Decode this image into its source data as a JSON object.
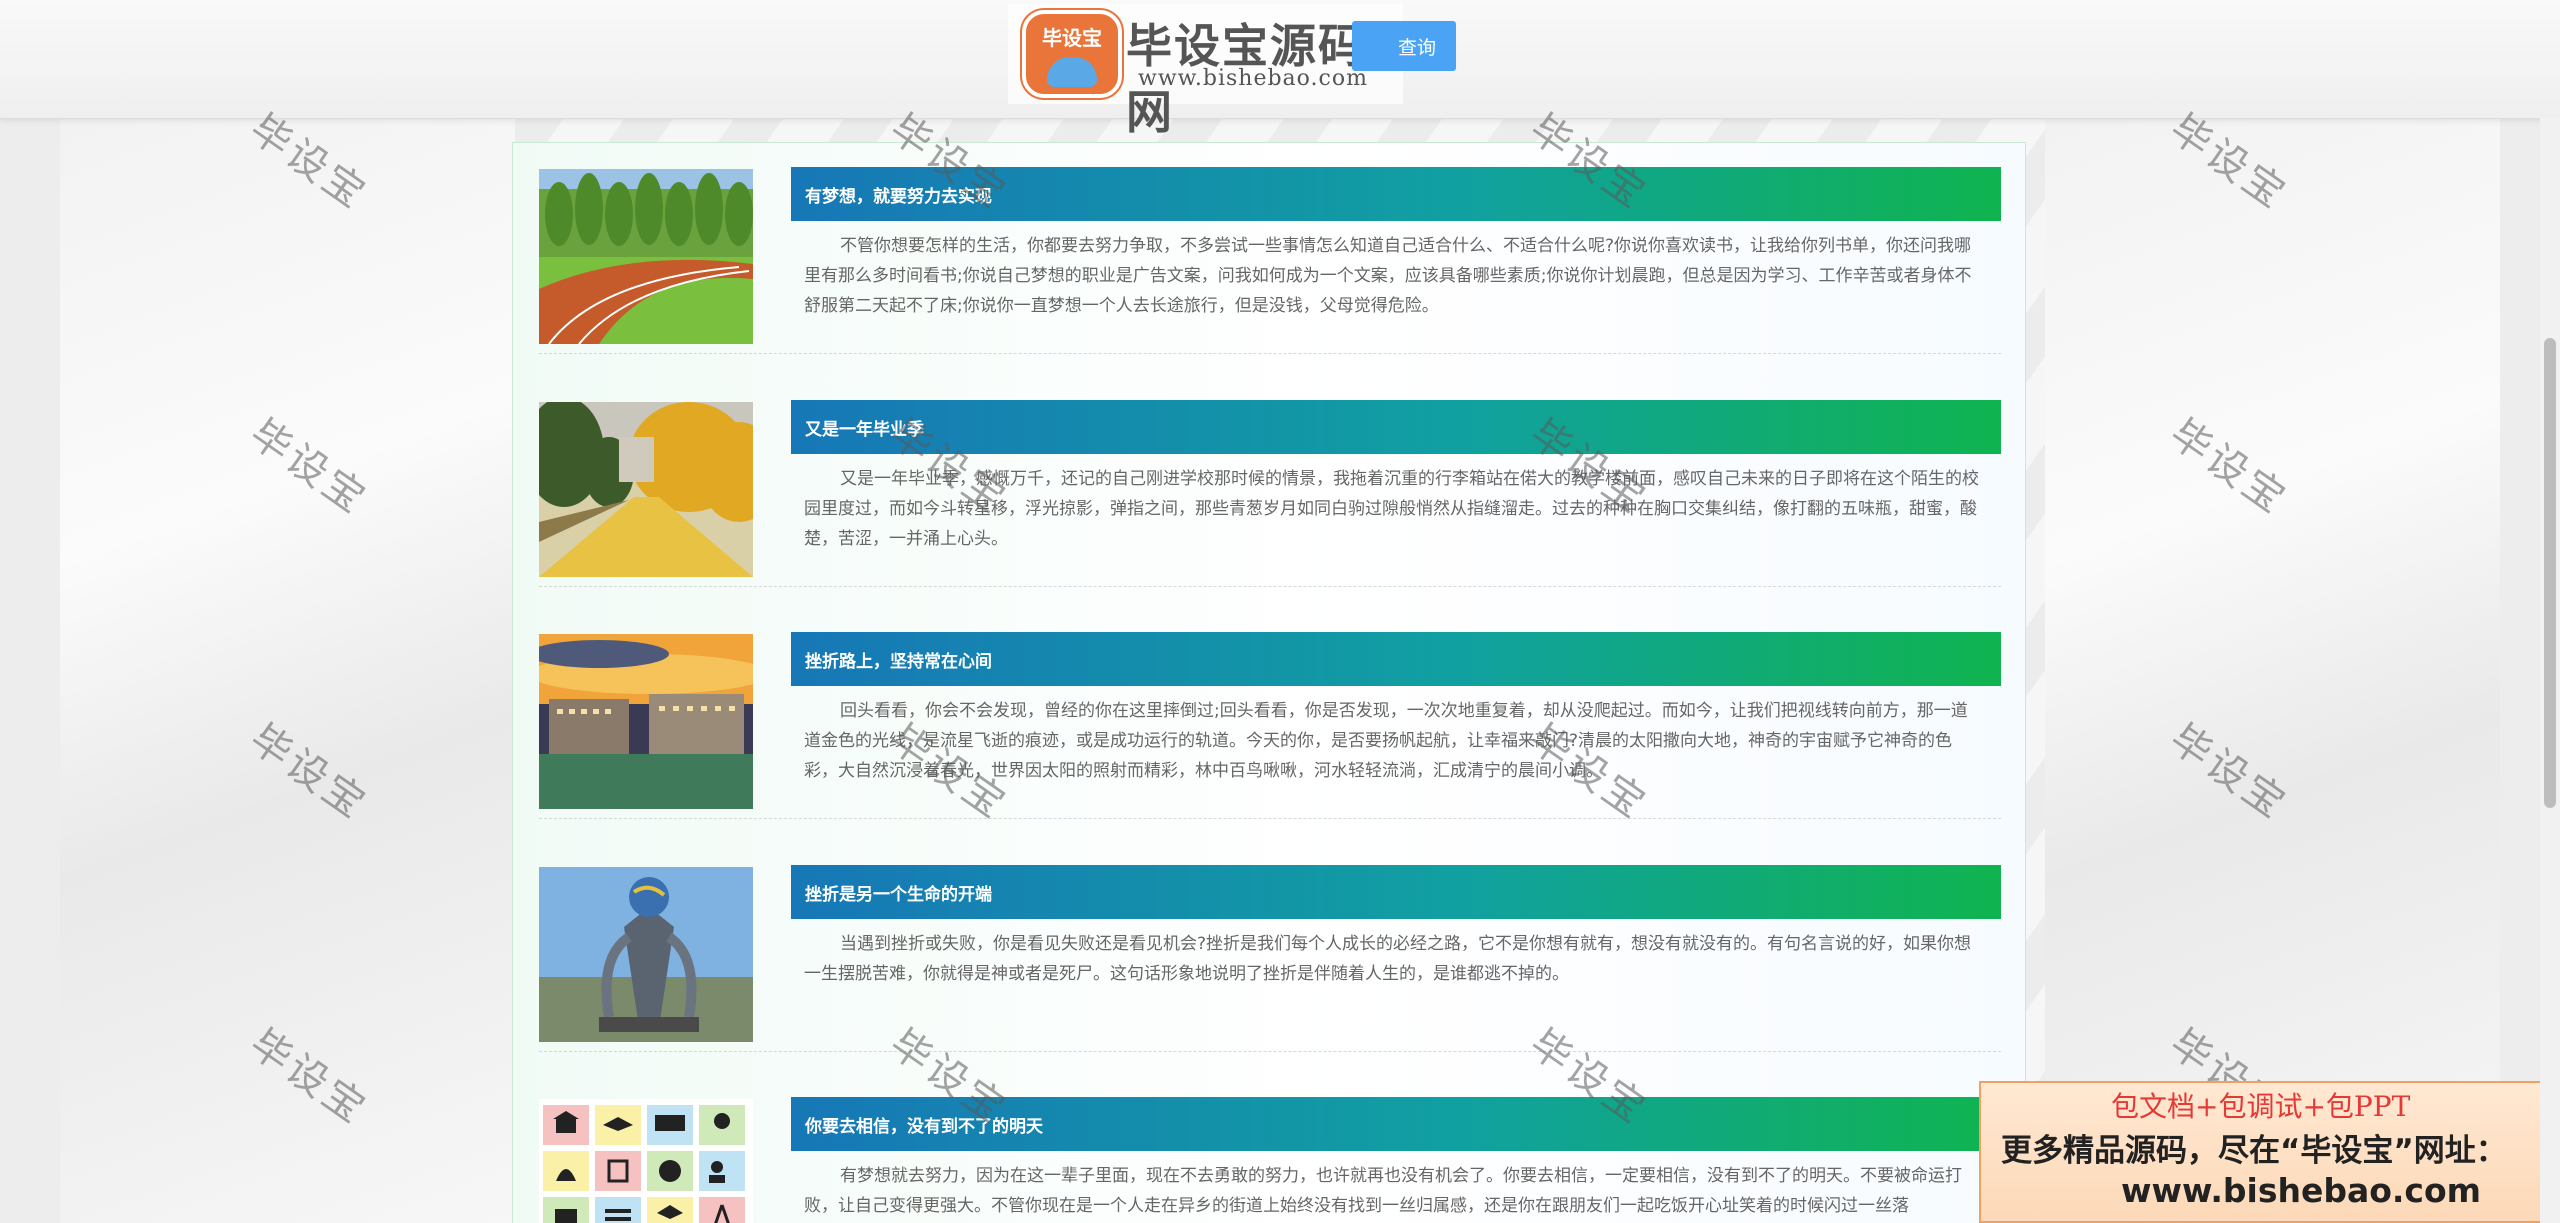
{
  "header": {
    "logo_badge": "毕设宝",
    "site_name": "毕设宝源码网",
    "site_url": "www.bishebao.com",
    "query_button": "查询"
  },
  "articles": [
    {
      "title": "有梦想，就要努力去实现",
      "summary": "不管你想要怎样的生活，你都要去努力争取，不多尝试一些事情怎么知道自己适合什么、不适合什么呢?你说你喜欢读书，让我给你列书单，你还问我哪里有那么多时间看书;你说自己梦想的职业是广告文案，问我如何成为一个文案，应该具备哪些素质;你说你计划晨跑，但总是因为学习、工作辛苦或者身体不舒服第二天起不了床;你说你一直梦想一个人去长途旅行，但是没钱，父母觉得危险。",
      "image": "running-track"
    },
    {
      "title": "又是一年毕业季",
      "summary": "又是一年毕业季，感慨万千，还记的自己刚进学校那时候的情景，我拖着沉重的行李箱站在偌大的教学楼前面，感叹自己未来的日子即将在这个陌生的校园里度过，而如今斗转星移，浮光掠影，弹指之间，那些青葱岁月如同白驹过隙般悄然从指缝溜走。过去的种种在胸口交集纠结，像打翻的五味瓶，甜蜜，酸楚，苦涩，一并涌上心头。",
      "image": "autumn-campus"
    },
    {
      "title": "挫折路上，坚持常在心间",
      "summary": "回头看看，你会不会发现，曾经的你在这里摔倒过;回头看看，你是否发现，一次次地重复着，却从没爬起过。而如今，让我们把视线转向前方，那一道道金色的光线，是流星飞逝的痕迹，或是成功运行的轨道。今天的你，是否要扬帆起航，让幸福来敲门?清晨的太阳撒向大地，神奇的宇宙赋予它神奇的色彩，大自然沉浸着春光，世界因太阳的照射而精彩，林中百鸟啾啾，河水轻轻流淌，汇成清宁的晨间小调。",
      "image": "campus-sunset"
    },
    {
      "title": "挫折是另一个生命的开端",
      "summary": "当遇到挫折或失败，你是看见失败还是看见机会?挫折是我们每个人成长的必经之路，它不是你想有就有，想没有就没有的。有句名言说的好，如果你想一生摆脱苦难，你就得是神或者是死尸。这句话形象地说明了挫折是伴随着人生的，是谁都逃不掉的。",
      "image": "globe-sculpture"
    },
    {
      "title": "你要去相信，没有到不了的明天",
      "summary": "有梦想就去努力，因为在这一辈子里面，现在不去勇敢的努力，也许就再也没有机会了。你要去相信，一定要相信，没有到不了的明天。不要被命运打败，让自己变得更强大。不管你现在是一个人走在异乡的街道上始终没有找到一丝归属感，还是你在跟朋友们一起吃饭开心址笑着的时候闪过一丝落",
      "image": "icon-grid"
    }
  ],
  "watermark_text": "毕设宝",
  "ad": {
    "line1": "包文档+包调试+包PPT",
    "line2": "更多精品源码，尽在“毕设宝”网址：",
    "line3": "www.bishebao.com"
  }
}
